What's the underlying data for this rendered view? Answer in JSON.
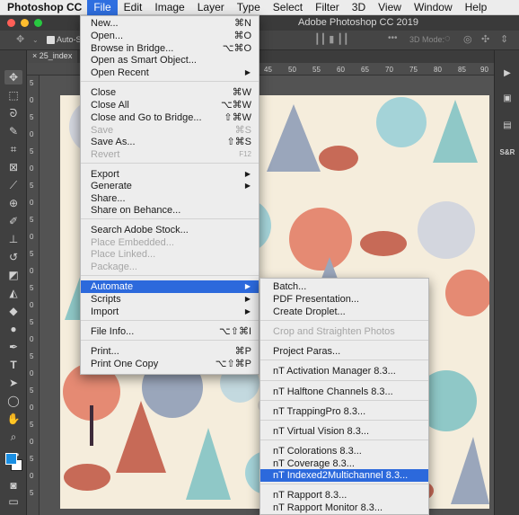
{
  "menubar": {
    "app_name": "Photoshop CC",
    "items": [
      "File",
      "Edit",
      "Image",
      "Layer",
      "Type",
      "Select",
      "Filter",
      "3D",
      "View",
      "Window",
      "Help"
    ]
  },
  "window": {
    "title": "Adobe Photoshop CC 2019",
    "traffic_lights": [
      "#ff5f57",
      "#febc2e",
      "#28c840"
    ]
  },
  "options_bar": {
    "auto_select_label": "Auto-S",
    "mode_label": "3D Mode:",
    "more_label": "•••"
  },
  "document": {
    "tab_label": "25_index",
    "ruler_h": [
      "45",
      "50",
      "55",
      "60",
      "65",
      "70",
      "75",
      "80",
      "85",
      "90"
    ],
    "ruler_v": [
      "5",
      "0",
      "5",
      "0",
      "5",
      "0",
      "5",
      "0",
      "5",
      "0",
      "5",
      "0",
      "5",
      "0",
      "5",
      "0",
      "5",
      "0",
      "5",
      "0",
      "5",
      "0",
      "5",
      "0",
      "5"
    ]
  },
  "toolbar": {
    "foreground_color": "#1a8fe3",
    "background_color": "#ffffff"
  },
  "right_panel": {
    "sr_label": "S&R"
  },
  "file_menu": {
    "items": [
      {
        "label": "New...",
        "shortcut": "⌘N"
      },
      {
        "label": "Open...",
        "shortcut": "⌘O"
      },
      {
        "label": "Browse in Bridge...",
        "shortcut": "⌥⌘O"
      },
      {
        "label": "Open as Smart Object...",
        "shortcut": ""
      },
      {
        "label": "Open Recent",
        "submenu": true
      },
      {
        "label": "Close",
        "shortcut": "⌘W"
      },
      {
        "label": "Close All",
        "shortcut": "⌥⌘W"
      },
      {
        "label": "Close and Go to Bridge...",
        "shortcut": "⇧⌘W"
      },
      {
        "label": "Save",
        "shortcut": "⌘S",
        "disabled": true
      },
      {
        "label": "Save As...",
        "shortcut": "⇧⌘S"
      },
      {
        "label": "Revert",
        "shortcut": "F12",
        "disabled": true
      },
      {
        "label": "Export",
        "submenu": true
      },
      {
        "label": "Generate",
        "submenu": true
      },
      {
        "label": "Share...",
        "shortcut": ""
      },
      {
        "label": "Share on Behance...",
        "shortcut": ""
      },
      {
        "label": "Search Adobe Stock...",
        "shortcut": ""
      },
      {
        "label": "Place Embedded...",
        "disabled": true
      },
      {
        "label": "Place Linked...",
        "disabled": true
      },
      {
        "label": "Package...",
        "disabled": true
      },
      {
        "label": "Automate",
        "submenu": true,
        "highlight": true
      },
      {
        "label": "Scripts",
        "submenu": true
      },
      {
        "label": "Import",
        "submenu": true
      },
      {
        "label": "File Info...",
        "shortcut": "⌥⇧⌘I"
      },
      {
        "label": "Print...",
        "shortcut": "⌘P"
      },
      {
        "label": "Print One Copy",
        "shortcut": "⌥⇧⌘P"
      }
    ]
  },
  "automate_submenu": {
    "items": [
      {
        "label": "Batch..."
      },
      {
        "label": "PDF Presentation..."
      },
      {
        "label": "Create Droplet..."
      },
      {
        "label": "Crop and Straighten Photos",
        "disabled": true
      },
      {
        "label": "Project Paras..."
      },
      {
        "label": "nT Activation Manager 8.3..."
      },
      {
        "label": "nT Halftone Channels 8.3..."
      },
      {
        "label": "nT TrappingPro 8.3..."
      },
      {
        "label": "nT Virtual Vision 8.3..."
      },
      {
        "label": "nT Colorations 8.3..."
      },
      {
        "label": "nT Coverage 8.3..."
      },
      {
        "label": "nT Indexed2Multichannel 8.3...",
        "highlight": true
      },
      {
        "label": "nT Rapport 8.3..."
      },
      {
        "label": "nT Rapport Monitor 8.3..."
      }
    ]
  }
}
